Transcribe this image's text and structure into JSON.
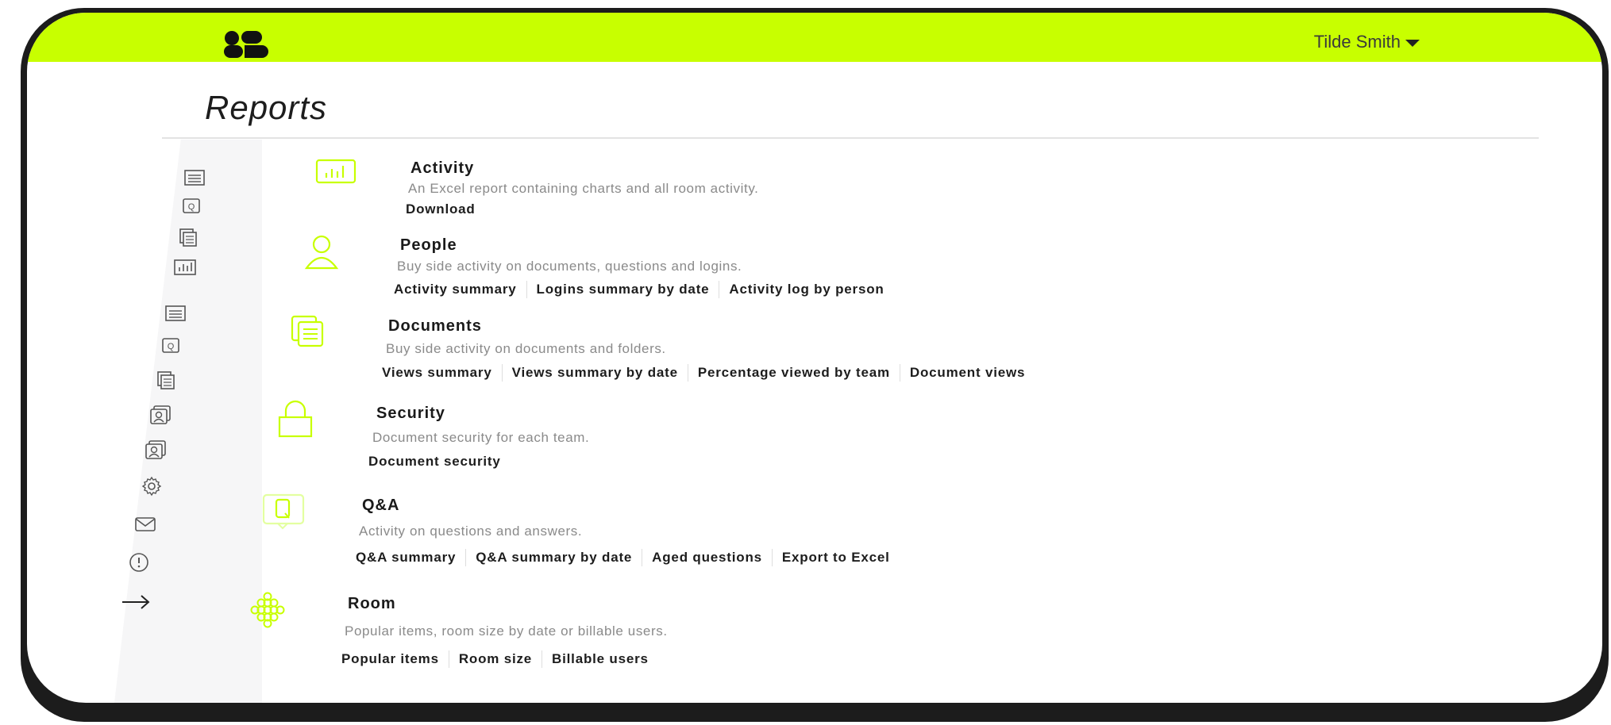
{
  "header": {
    "user_name": "Tilde Smith",
    "accent_color": "#c8ff00"
  },
  "page": {
    "title": "Reports"
  },
  "sidebar": {
    "icons": [
      "document-list-icon",
      "qa-icon",
      "documents-icon",
      "chart-icon",
      "document-list-icon",
      "qa-icon",
      "documents-icon",
      "people-icon",
      "people-icon",
      "gear-icon",
      "mail-icon",
      "alert-icon",
      "arrow-right-icon"
    ]
  },
  "reports": [
    {
      "icon": "chart-icon",
      "title": "Activity",
      "description": "An Excel report containing charts and all room activity.",
      "links": [
        "Download"
      ]
    },
    {
      "icon": "person-icon",
      "title": "People",
      "description": "Buy side activity on documents, questions and logins.",
      "links": [
        "Activity summary",
        "Logins summary by date",
        "Activity log by person"
      ]
    },
    {
      "icon": "documents-icon",
      "title": "Documents",
      "description": "Buy side activity on documents and folders.",
      "links": [
        "Views summary",
        "Views summary by date",
        "Percentage viewed by team",
        "Document views"
      ]
    },
    {
      "icon": "lock-icon",
      "title": "Security",
      "description": "Document security for each team.",
      "links": [
        "Document security"
      ]
    },
    {
      "icon": "qa-icon",
      "title": "Q&A",
      "description": "Activity on questions and answers.",
      "links": [
        "Q&A summary",
        "Q&A summary by date",
        "Aged questions",
        "Export to Excel"
      ]
    },
    {
      "icon": "room-icon",
      "title": "Room",
      "description": "Popular items, room size by date or billable users.",
      "links": [
        "Popular items",
        "Room size",
        "Billable users"
      ]
    }
  ]
}
